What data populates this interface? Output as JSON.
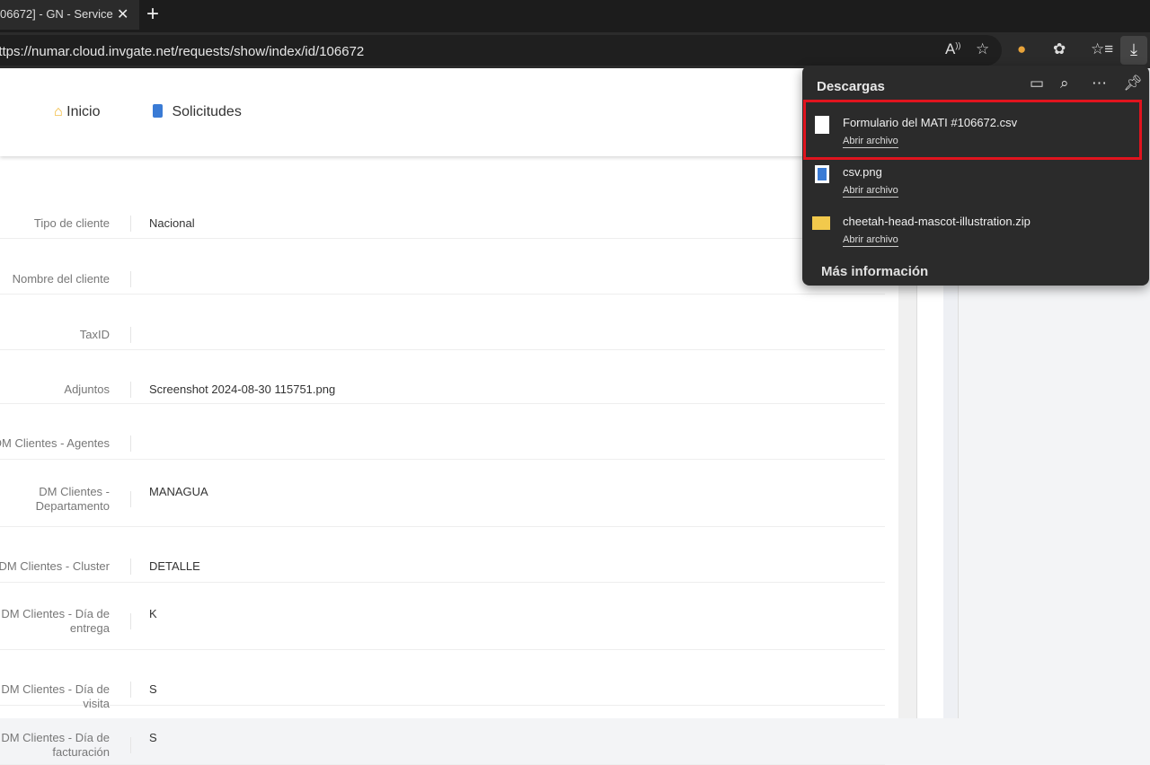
{
  "browser": {
    "tab_title": "06672] - GN - Service",
    "tab_close": "✕",
    "new_tab": "+",
    "url": "https://numar.cloud.invgate.net/requests/show/index/id/106672"
  },
  "nav": {
    "home": "Inicio",
    "requests": "Solicitudes",
    "home_color": "#f0b429",
    "requests_color": "#3a7bd5"
  },
  "fields": [
    {
      "label": "Tipo de cliente",
      "value": "Nacional"
    },
    {
      "label": "Nombre del cliente",
      "value": ""
    },
    {
      "label": "TaxID",
      "value": ""
    },
    {
      "label": "Adjuntos",
      "value": "Screenshot 2024-08-30 115751.png"
    },
    {
      "label": "DM Clientes - Agentes",
      "value": ""
    },
    {
      "label": "DM Clientes - Departamento",
      "value": "MANAGUA"
    },
    {
      "label": "DM Clientes - Cluster",
      "value": "DETALLE"
    },
    {
      "label": "DM Clientes - Día de entrega",
      "value": "K"
    },
    {
      "label": "DM Clientes - Día de visita",
      "value": "S"
    },
    {
      "label": "DM Clientes - Día de facturación",
      "value": "S"
    }
  ],
  "downloads": {
    "title": "Descargas",
    "items": [
      {
        "name": "Formulario del MATI #106672.csv",
        "action": "Abrir archivo",
        "icon": "file-icon"
      },
      {
        "name": "csv.png",
        "action": "Abrir archivo",
        "icon": "image-file-icon"
      },
      {
        "name": "cheetah-head-mascot-illustration.zip",
        "action": "Abrir archivo",
        "icon": "zip-folder-icon"
      }
    ],
    "more": "Más información",
    "highlight_color": "#e0141e"
  }
}
